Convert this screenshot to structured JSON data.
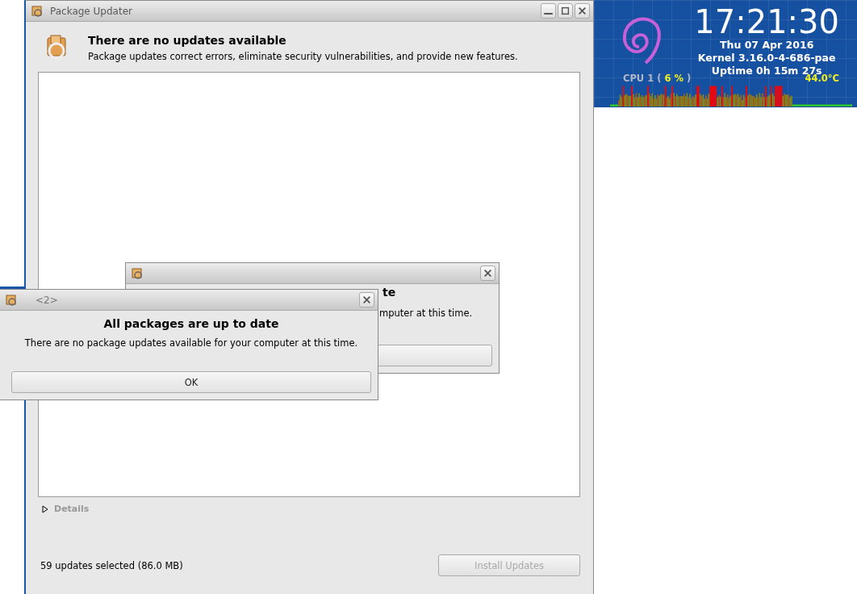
{
  "main_window": {
    "title": "Package Updater",
    "heading": "There are no updates available",
    "description": "Package updates correct errors, eliminate security vulnerabilities, and provide new features.",
    "details": {
      "label": "Details",
      "expanded": false
    },
    "status": "59 updates selected (86.0 MB)",
    "install_button": {
      "label": "Install Updates",
      "disabled": true
    }
  },
  "back_dialog": {
    "heading_fragment": "te",
    "message_fragment": "mputer at this time."
  },
  "dialog": {
    "title": "<2>",
    "heading": "All packages are up to date",
    "message": "There are no package updates available for your computer at this time.",
    "button": "OK"
  },
  "conky": {
    "time": "17:21:30",
    "date": "Thu 07 Apr 2016",
    "kernel": "Kernel 3.16.0-4-686-pae",
    "uptime": "Uptime 0h 15m 27s",
    "cpu_label": "CPU 1 (",
    "cpu_value": "6 %",
    "cpu_close": ")",
    "temperature": "44.0°C"
  }
}
